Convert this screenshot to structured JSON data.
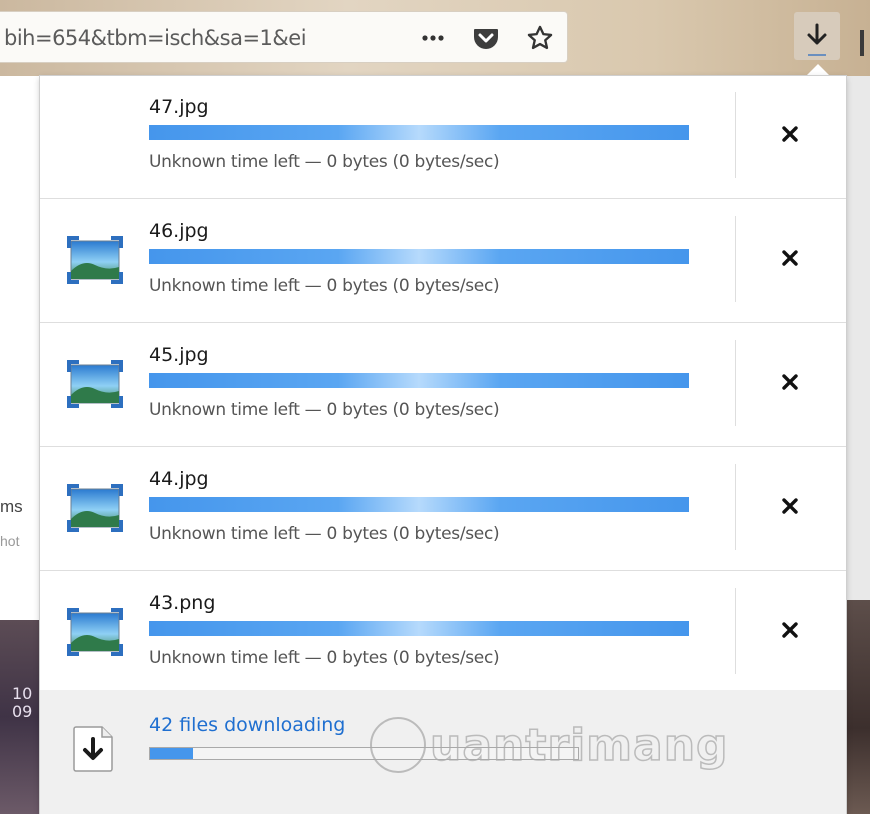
{
  "toolbar": {
    "url_text": "bih=654&tbm=isch&sa=1&ei",
    "more_icon": "more-dots-icon",
    "pocket_icon": "pocket-icon",
    "bookmark_icon": "star-icon",
    "downloads_icon": "download-arrow-icon"
  },
  "background_page": {
    "left_text_1": "ms",
    "left_text_2": "hot",
    "left_num_1": "10",
    "left_num_2": "09"
  },
  "downloads": {
    "items": [
      {
        "name": "47.jpg",
        "status": "Unknown time left — 0 bytes (0 bytes/sec)",
        "has_icon": false
      },
      {
        "name": "46.jpg",
        "status": "Unknown time left — 0 bytes (0 bytes/sec)",
        "has_icon": true
      },
      {
        "name": "45.jpg",
        "status": "Unknown time left — 0 bytes (0 bytes/sec)",
        "has_icon": true
      },
      {
        "name": "44.jpg",
        "status": "Unknown time left — 0 bytes (0 bytes/sec)",
        "has_icon": true
      },
      {
        "name": "43.png",
        "status": "Unknown time left — 0 bytes (0 bytes/sec)",
        "has_icon": true
      }
    ],
    "cancel_icon": "close-icon",
    "footer": {
      "text": "42 files downloading",
      "progress": 0.1
    }
  },
  "watermark": "uantrimang",
  "colors": {
    "accent": "#4596ec",
    "link": "#1f6fd0"
  }
}
